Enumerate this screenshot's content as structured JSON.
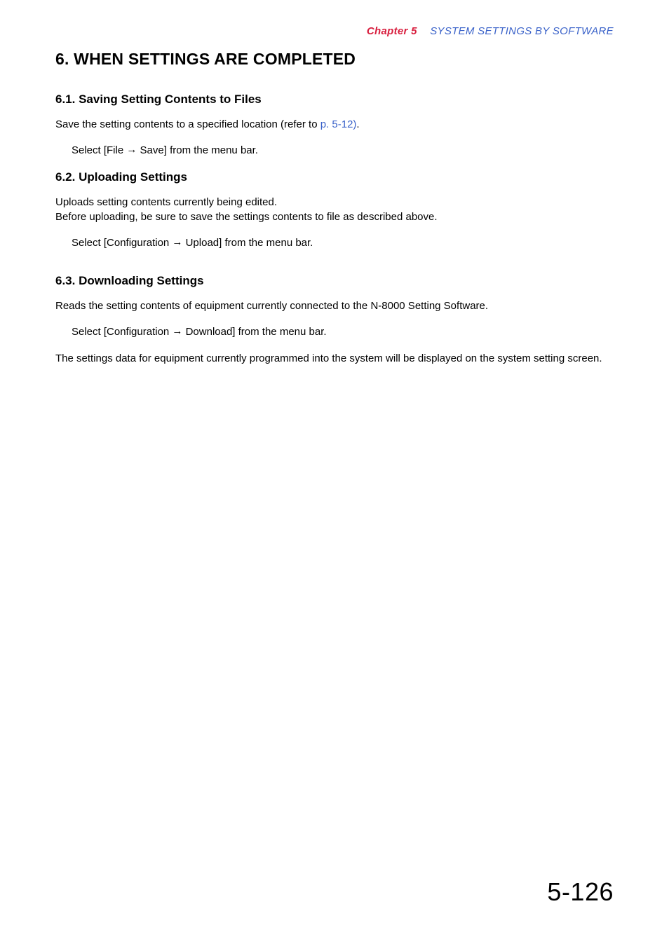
{
  "header": {
    "chapter_label": "Chapter 5",
    "chapter_title": "SYSTEM SETTINGS BY SOFTWARE"
  },
  "title": "6. WHEN SETTINGS ARE COMPLETED",
  "sections": {
    "s61": {
      "heading": "6.1. Saving Setting Contents to Files",
      "intro_prefix": "Save the setting contents to a specified location (refer to ",
      "intro_link": "p. 5-12)",
      "intro_suffix": ".",
      "step_prefix": "Select [File ",
      "step_suffix": " Save] from the menu bar."
    },
    "s62": {
      "heading": "6.2. Uploading Settings",
      "intro_line1": "Uploads setting contents currently being edited.",
      "intro_line2": "Before uploading, be sure to save the settings contents to file as described above.",
      "step_prefix": "Select [Configuration ",
      "step_suffix": " Upload] from the menu bar."
    },
    "s63": {
      "heading": "6.3. Downloading Settings",
      "intro": "Reads the setting contents of equipment currently connected to the N-8000 Setting Software.",
      "step_prefix": "Select [Configuration ",
      "step_suffix": " Download] from the menu bar.",
      "outro": "The settings data for equipment currently programmed into the system will be displayed on the system setting screen."
    }
  },
  "page_number": "5-126",
  "glyphs": {
    "arrow": "→"
  }
}
